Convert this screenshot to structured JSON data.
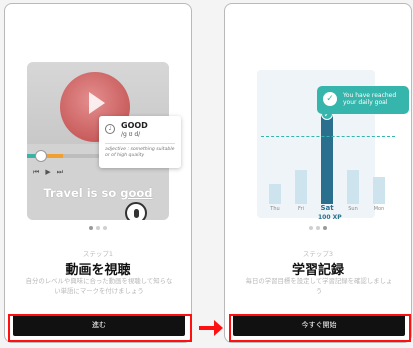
{
  "screen1": {
    "dictionary": {
      "word": "GOOD",
      "ipa": "/g ʊ d/",
      "definition": "adjective : something suitable or of high quality",
      "speaker_icon": "speaker-icon"
    },
    "subtitle_prefix": "Travel is so ",
    "subtitle_word": "good",
    "video_progress": 0.1,
    "step_label": "ステップ1",
    "title": "動画を視聴",
    "description": "自分のレベルや興味に合った動画を視聴して知らない単語にマークを付けましょう",
    "button_label": "進む",
    "page_dots": 3,
    "active_dot": 0
  },
  "screen2": {
    "toast_line1": "You have reached",
    "toast_line2": "your daily goal",
    "chart_data": {
      "type": "bar",
      "categories": [
        "Thu",
        "Fri",
        "Sat",
        "Sun",
        "Mon"
      ],
      "values": [
        22,
        38,
        100,
        38,
        30
      ],
      "highlight_index": 2,
      "goal_line": 75,
      "highlight_value_label": "100 XP"
    },
    "step_label": "ステップ3",
    "title": "学習記録",
    "description": "毎日の学習目標を設定して学習記録を確認しましょう",
    "button_label": "今すぐ開始",
    "page_dots": 3,
    "active_dot": 2
  },
  "colors": {
    "accent_teal": "#35b5ab",
    "bar_highlight": "#2b6f8e",
    "button": "#111111",
    "highlight_red": "#ff1010"
  }
}
